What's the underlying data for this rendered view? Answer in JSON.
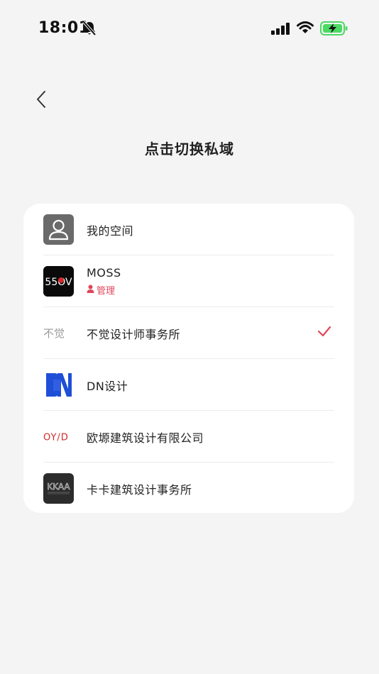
{
  "status_bar": {
    "time": "18:01",
    "icons": [
      "bell-muted-icon",
      "signal-icon",
      "wifi-icon",
      "battery-charging-icon"
    ],
    "battery_color": "#4cd964"
  },
  "header": {
    "title": "点击切换私域",
    "back_icon": "chevron-left-icon"
  },
  "workspaces": [
    {
      "name": "我的空间",
      "logo": "person-avatar-icon",
      "badge": "",
      "selected": false
    },
    {
      "name": "MOSS",
      "logo": "moss-logo",
      "logo_text": "55OV",
      "badge": "管理",
      "selected": false
    },
    {
      "name": "不觉设计师事务所",
      "logo": "bujue-logo",
      "logo_text": "不觉",
      "badge": "",
      "selected": true
    },
    {
      "name": "DN设计",
      "logo": "dn-logo",
      "logo_text": "DN",
      "badge": "",
      "selected": false
    },
    {
      "name": "欧塬建筑设计有限公司",
      "logo": "oyad-logo",
      "logo_text": "OYAD",
      "badge": "",
      "selected": false
    },
    {
      "name": "卡卡建筑设计事务所",
      "logo": "kkaa-logo",
      "logo_text": "KKAA",
      "badge": "",
      "selected": false
    }
  ],
  "colors": {
    "accent": "#e0455a",
    "dn_blue": "#1f4fd6",
    "oyad_red": "#d22a2a",
    "background": "#f4f4f4",
    "card": "#ffffff"
  }
}
